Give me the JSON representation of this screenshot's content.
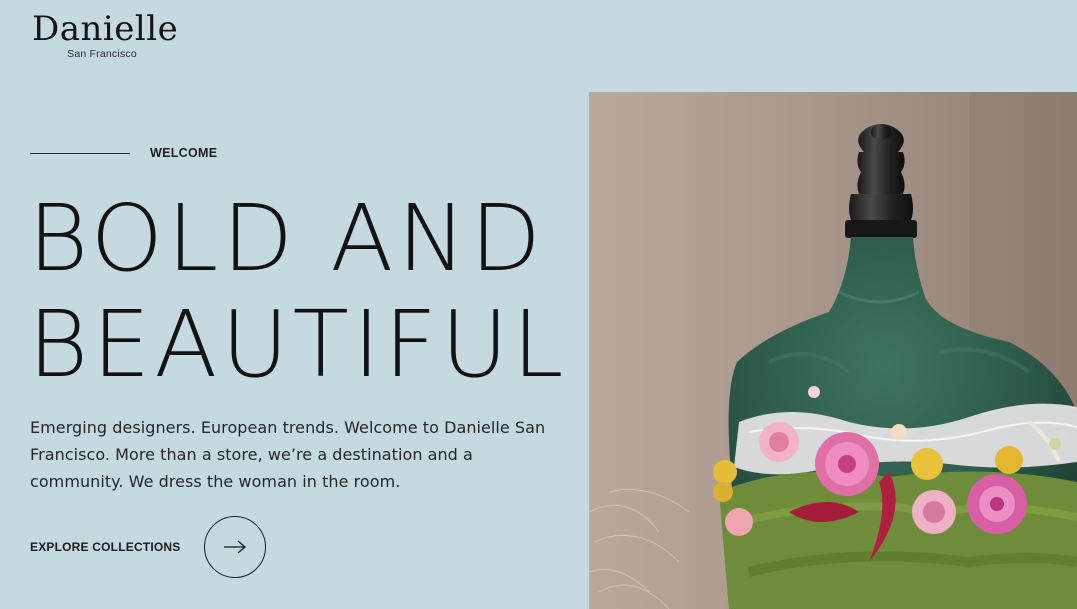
{
  "brand": {
    "name": "Danielle",
    "location": "San Francisco"
  },
  "hero": {
    "eyebrow": "WELCOME",
    "headline_line1": "BOLD AND",
    "headline_line2": "BEAUTIFUL",
    "description": "Emerging designers. European trends. Welcome to Danielle San Francisco. More than a store, we’re a destination and a community. We dress the woman in the room.",
    "cta_label": "EXPLORE COLLECTIONS",
    "image_alt": "green velvet dress form decorated with flowers"
  },
  "colors": {
    "background": "#c5d9e1",
    "text": "#1b1b1b",
    "velvet": "#2f5a4a"
  },
  "icons": {
    "cta_arrow": "arrow-right-icon"
  }
}
